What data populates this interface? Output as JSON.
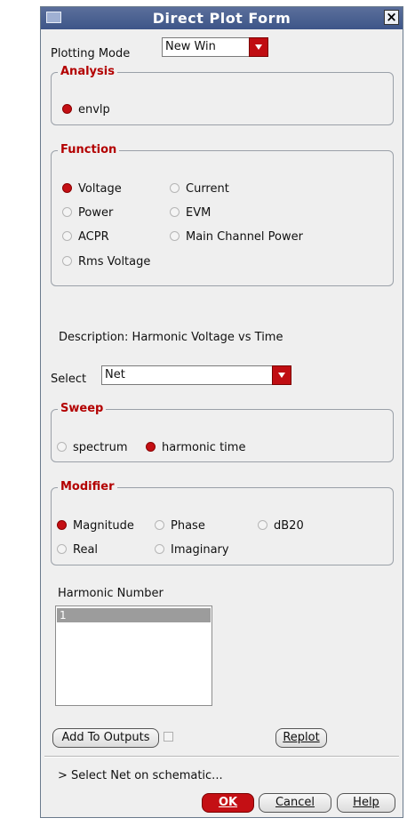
{
  "window": {
    "title": "Direct Plot Form",
    "close_symbol": "×"
  },
  "plotting_mode": {
    "label": "Plotting Mode",
    "value": "New Win"
  },
  "analysis": {
    "legend": "Analysis",
    "option": "envlp",
    "selected": true
  },
  "function": {
    "legend": "Function",
    "options": [
      {
        "label": "Voltage",
        "selected": true
      },
      {
        "label": "Current",
        "selected": false
      },
      {
        "label": "Power",
        "selected": false
      },
      {
        "label": "EVM",
        "selected": false
      },
      {
        "label": "ACPR",
        "selected": false
      },
      {
        "label": "Main Channel Power",
        "selected": false
      },
      {
        "label": "Rms Voltage",
        "selected": false
      }
    ]
  },
  "description": "Description: Harmonic Voltage vs Time",
  "select": {
    "label": "Select",
    "value": "Net"
  },
  "sweep": {
    "legend": "Sweep",
    "options": [
      {
        "label": "spectrum",
        "selected": false
      },
      {
        "label": "harmonic time",
        "selected": true
      }
    ]
  },
  "modifier": {
    "legend": "Modifier",
    "options": [
      {
        "label": "Magnitude",
        "selected": true
      },
      {
        "label": "Phase",
        "selected": false
      },
      {
        "label": "dB20",
        "selected": false
      },
      {
        "label": "Real",
        "selected": false
      },
      {
        "label": "Imaginary",
        "selected": false
      }
    ]
  },
  "harmonic_number": {
    "label": "Harmonic Number",
    "items": [
      "1"
    ],
    "selected_index": 0
  },
  "buttons": {
    "add_to_outputs": "Add To Outputs",
    "replot": "Replot",
    "ok": "OK",
    "cancel": "Cancel",
    "help": "Help"
  },
  "status_text": "> Select Net on schematic...",
  "colors": {
    "accent_red": "#c40f14",
    "title_bar": "#4a5f8f",
    "legend_text": "#b30000"
  }
}
